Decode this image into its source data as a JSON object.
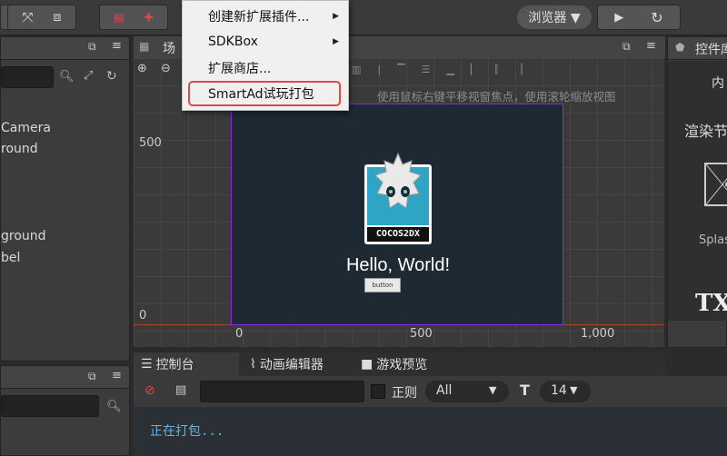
{
  "toolbar": {
    "browser_label": "浏览器 ▼",
    "play_icon": "play-icon",
    "refresh_icon": "refresh-icon"
  },
  "menu": {
    "items": [
      {
        "label": "创建新扩展插件...",
        "has_submenu": true
      },
      {
        "label": "SDKBox",
        "has_submenu": true
      },
      {
        "label": "扩展商店...",
        "has_submenu": false
      },
      {
        "label": "SmartAd试玩打包",
        "has_submenu": false,
        "highlighted": true
      }
    ],
    "highlight_color": "#e04848"
  },
  "hierarchy": {
    "items": [
      "Camera",
      "round",
      "ground",
      "bel"
    ]
  },
  "scene": {
    "title_partial": "场",
    "hint": "使用鼠标右键平移视窗焦点，使用滚轮缩放视图",
    "ruler_y": [
      "500",
      "0"
    ],
    "ruler_x": [
      "0",
      "500",
      "1,000"
    ],
    "canvas": {
      "logo_text": "COCOS2DX",
      "hello": "Hello, World!",
      "button_text": "button"
    }
  },
  "inspector": {
    "title": "控件库",
    "item1": "内",
    "item2": "渲染节",
    "item3": "Splas",
    "item4": "TX"
  },
  "console": {
    "tabs": [
      {
        "label": "控制台",
        "icon": "list-icon",
        "active": true
      },
      {
        "label": "动画编辑器",
        "icon": "animation-icon",
        "active": false
      },
      {
        "label": "游戏预览",
        "icon": "camera-icon",
        "active": false
      }
    ],
    "regex_label": "正则",
    "filter_value": "All",
    "font_size": "14",
    "log_line": "正在打包..."
  }
}
